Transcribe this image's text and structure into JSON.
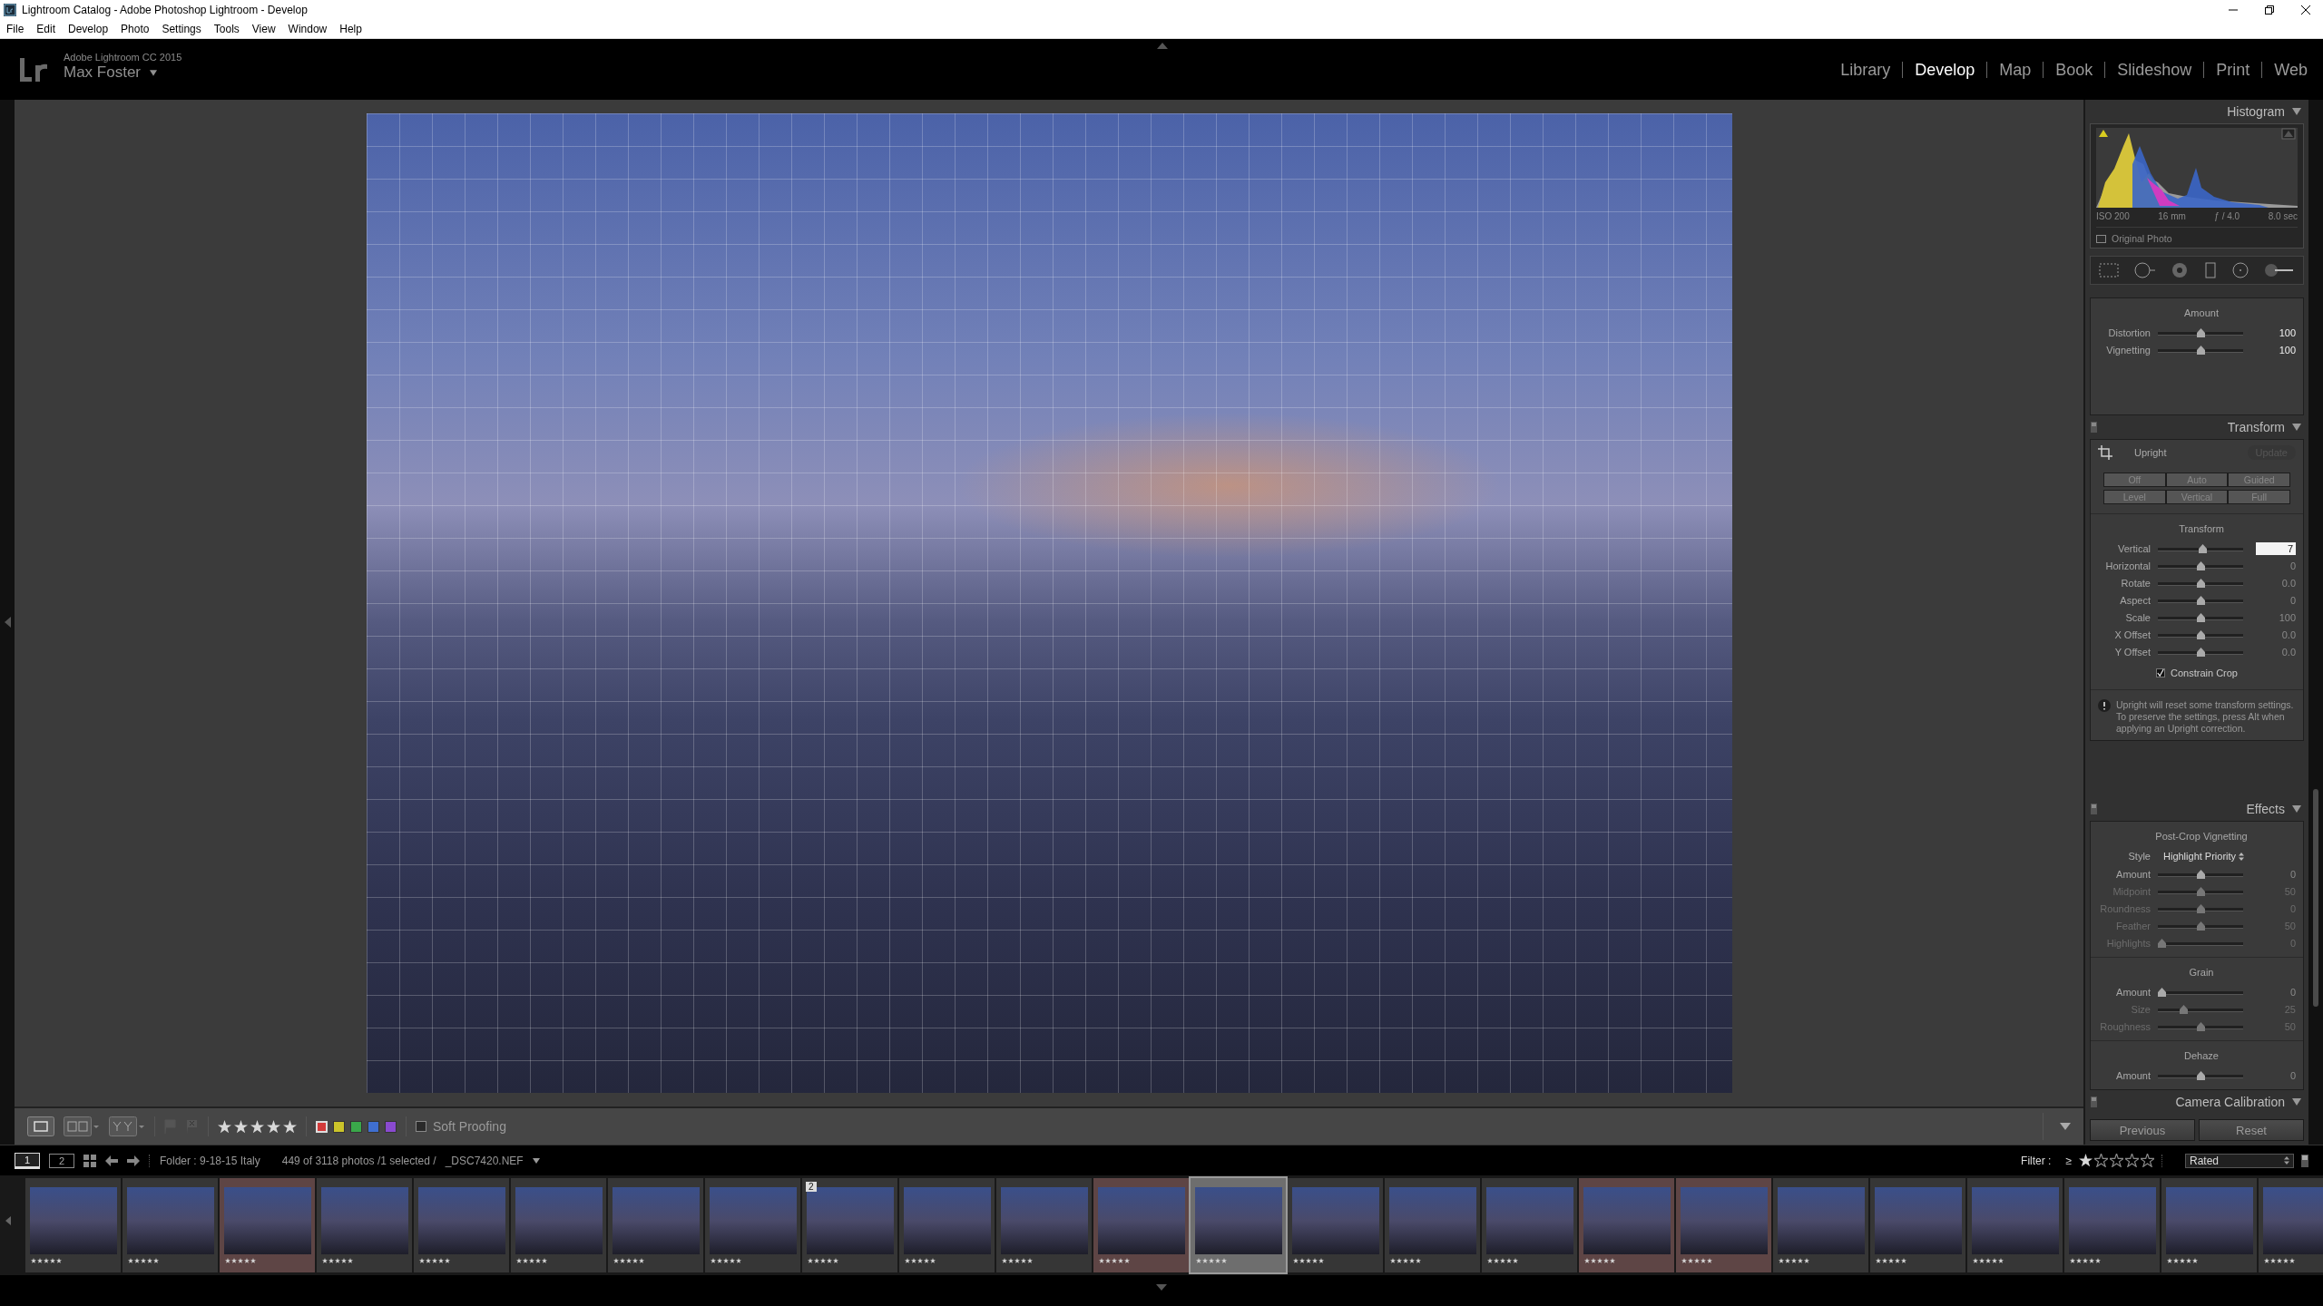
{
  "window": {
    "title": "Lightroom Catalog - Adobe Photoshop Lightroom - Develop"
  },
  "menu": [
    "File",
    "Edit",
    "Develop",
    "Photo",
    "Settings",
    "Tools",
    "View",
    "Window",
    "Help"
  ],
  "identity": {
    "product": "Adobe Lightroom CC 2015",
    "user": "Max Foster"
  },
  "modules": [
    {
      "label": "Library",
      "selected": false
    },
    {
      "label": "Develop",
      "selected": true
    },
    {
      "label": "Map",
      "selected": false
    },
    {
      "label": "Book",
      "selected": false
    },
    {
      "label": "Slideshow",
      "selected": false
    },
    {
      "label": "Print",
      "selected": false
    },
    {
      "label": "Web",
      "selected": false
    }
  ],
  "histogram": {
    "title": "Histogram",
    "expanded": true,
    "info": [
      "ISO 200",
      "16 mm",
      "ƒ / 4.0",
      "8.0 sec"
    ],
    "original_photo": {
      "label": "Original Photo",
      "checked": false
    }
  },
  "lens": {
    "heading": "Amount",
    "sliders": [
      {
        "label": "Distortion",
        "level": 0.5,
        "value": "100",
        "modified": true,
        "disabled": false
      },
      {
        "label": "Vignetting",
        "level": 0.5,
        "value": "100",
        "modified": true,
        "disabled": false
      }
    ]
  },
  "transform": {
    "title": "Transform",
    "expanded": true,
    "upright_label": "Upright",
    "update": {
      "label": "Update",
      "disabled": true
    },
    "upright_buttons": [
      "Off",
      "Auto",
      "Guided",
      "Level",
      "Vertical",
      "Full"
    ],
    "heading": "Transform",
    "sliders": [
      {
        "label": "Vertical",
        "level": 0.53,
        "value": "7",
        "kind": "field",
        "disabled": false
      },
      {
        "label": "Horizontal",
        "level": 0.5,
        "value": "0",
        "kind": "plain",
        "modified": false,
        "disabled": false
      },
      {
        "label": "Rotate",
        "level": 0.5,
        "value": "0.0",
        "kind": "plain",
        "modified": false,
        "disabled": false
      },
      {
        "label": "Aspect",
        "level": 0.5,
        "value": "0",
        "kind": "plain",
        "modified": false,
        "disabled": false
      },
      {
        "label": "Scale",
        "level": 0.5,
        "value": "100",
        "kind": "plain",
        "modified": false,
        "disabled": false
      },
      {
        "label": "X Offset",
        "level": 0.5,
        "value": "0.0",
        "kind": "plain",
        "modified": false,
        "disabled": false
      },
      {
        "label": "Y Offset",
        "level": 0.5,
        "value": "0.0",
        "kind": "plain",
        "modified": false,
        "disabled": false
      }
    ],
    "constrain_crop": {
      "label": "Constrain Crop",
      "checked": true
    },
    "note": "Upright will reset some transform settings. To preserve the settings, press Alt when applying an Upright correction."
  },
  "effects": {
    "title": "Effects",
    "expanded": true,
    "groups": [
      {
        "heading": "Post-Crop Vignetting",
        "style": {
          "label": "Style",
          "value": "Highlight Priority"
        },
        "sliders": [
          {
            "label": "Amount",
            "level": 0.5,
            "value": "0",
            "disabled": false
          },
          {
            "label": "Midpoint",
            "level": 0.5,
            "value": "50",
            "disabled": true
          },
          {
            "label": "Roundness",
            "level": 0.5,
            "value": "0",
            "disabled": true
          },
          {
            "label": "Feather",
            "level": 0.5,
            "value": "50",
            "disabled": true
          },
          {
            "label": "Highlights",
            "level": 0,
            "value": "0",
            "disabled": true
          }
        ]
      },
      {
        "heading": "Grain",
        "sliders": [
          {
            "label": "Amount",
            "level": 0,
            "value": "0",
            "disabled": false
          },
          {
            "label": "Size",
            "level": 0.28,
            "value": "25",
            "disabled": true
          },
          {
            "label": "Roughness",
            "level": 0.5,
            "value": "50",
            "disabled": true
          }
        ]
      },
      {
        "heading": "Dehaze",
        "sliders": [
          {
            "label": "Amount",
            "level": 0.5,
            "value": "0",
            "disabled": false
          }
        ]
      }
    ]
  },
  "camera_calibration": {
    "title": "Camera Calibration",
    "expanded": true
  },
  "panel_buttons": [
    "Previous",
    "Reset"
  ],
  "toolbar": {
    "rating": {
      "stars": 5
    },
    "color_labels": [
      {
        "color": "#d23a3a",
        "selected": true
      },
      {
        "color": "#cbc42a",
        "selected": false
      },
      {
        "color": "#3aa84a",
        "selected": false
      },
      {
        "color": "#3f6fd0",
        "selected": false
      },
      {
        "color": "#8a4ad0",
        "selected": false
      }
    ],
    "soft_proofing": {
      "label": "Soft Proofing",
      "checked": false
    }
  },
  "filmstrip": {
    "pages": [
      {
        "label": "1",
        "selected": true
      },
      {
        "label": "2",
        "selected": false
      }
    ],
    "source": "Folder : 9-18-15 Italy",
    "count": "449 of 3118 photos /1 selected /",
    "filename": "_DSC7420.NEF",
    "filter": {
      "label": "Filter :",
      "symbol": "≥",
      "stars": 1,
      "preset": "Rated"
    },
    "thumbnails": [
      {
        "selected": false,
        "stars": 5
      },
      {
        "selected": false,
        "stars": 5
      },
      {
        "selected": false,
        "stars": 5,
        "color": "#5e4545"
      },
      {
        "selected": false,
        "stars": 5
      },
      {
        "selected": false,
        "stars": 5
      },
      {
        "selected": false,
        "stars": 5
      },
      {
        "selected": false,
        "stars": 5
      },
      {
        "selected": false,
        "stars": 5
      },
      {
        "selected": false,
        "stars": 5,
        "stack": "2"
      },
      {
        "selected": false,
        "stars": 5
      },
      {
        "selected": false,
        "stars": 5
      },
      {
        "selected": false,
        "stars": 5,
        "color": "#5e4545"
      },
      {
        "selected": true,
        "stars": 5
      },
      {
        "selected": false,
        "stars": 5
      },
      {
        "selected": false,
        "stars": 5
      },
      {
        "selected": false,
        "stars": 5
      },
      {
        "selected": false,
        "stars": 5,
        "color": "#5e4545"
      },
      {
        "selected": false,
        "stars": 5,
        "color": "#5e4545"
      },
      {
        "selected": false,
        "stars": 5
      },
      {
        "selected": false,
        "stars": 5
      },
      {
        "selected": false,
        "stars": 5
      },
      {
        "selected": false,
        "stars": 5
      },
      {
        "selected": false,
        "stars": 5
      },
      {
        "selected": false,
        "stars": 5
      }
    ]
  }
}
